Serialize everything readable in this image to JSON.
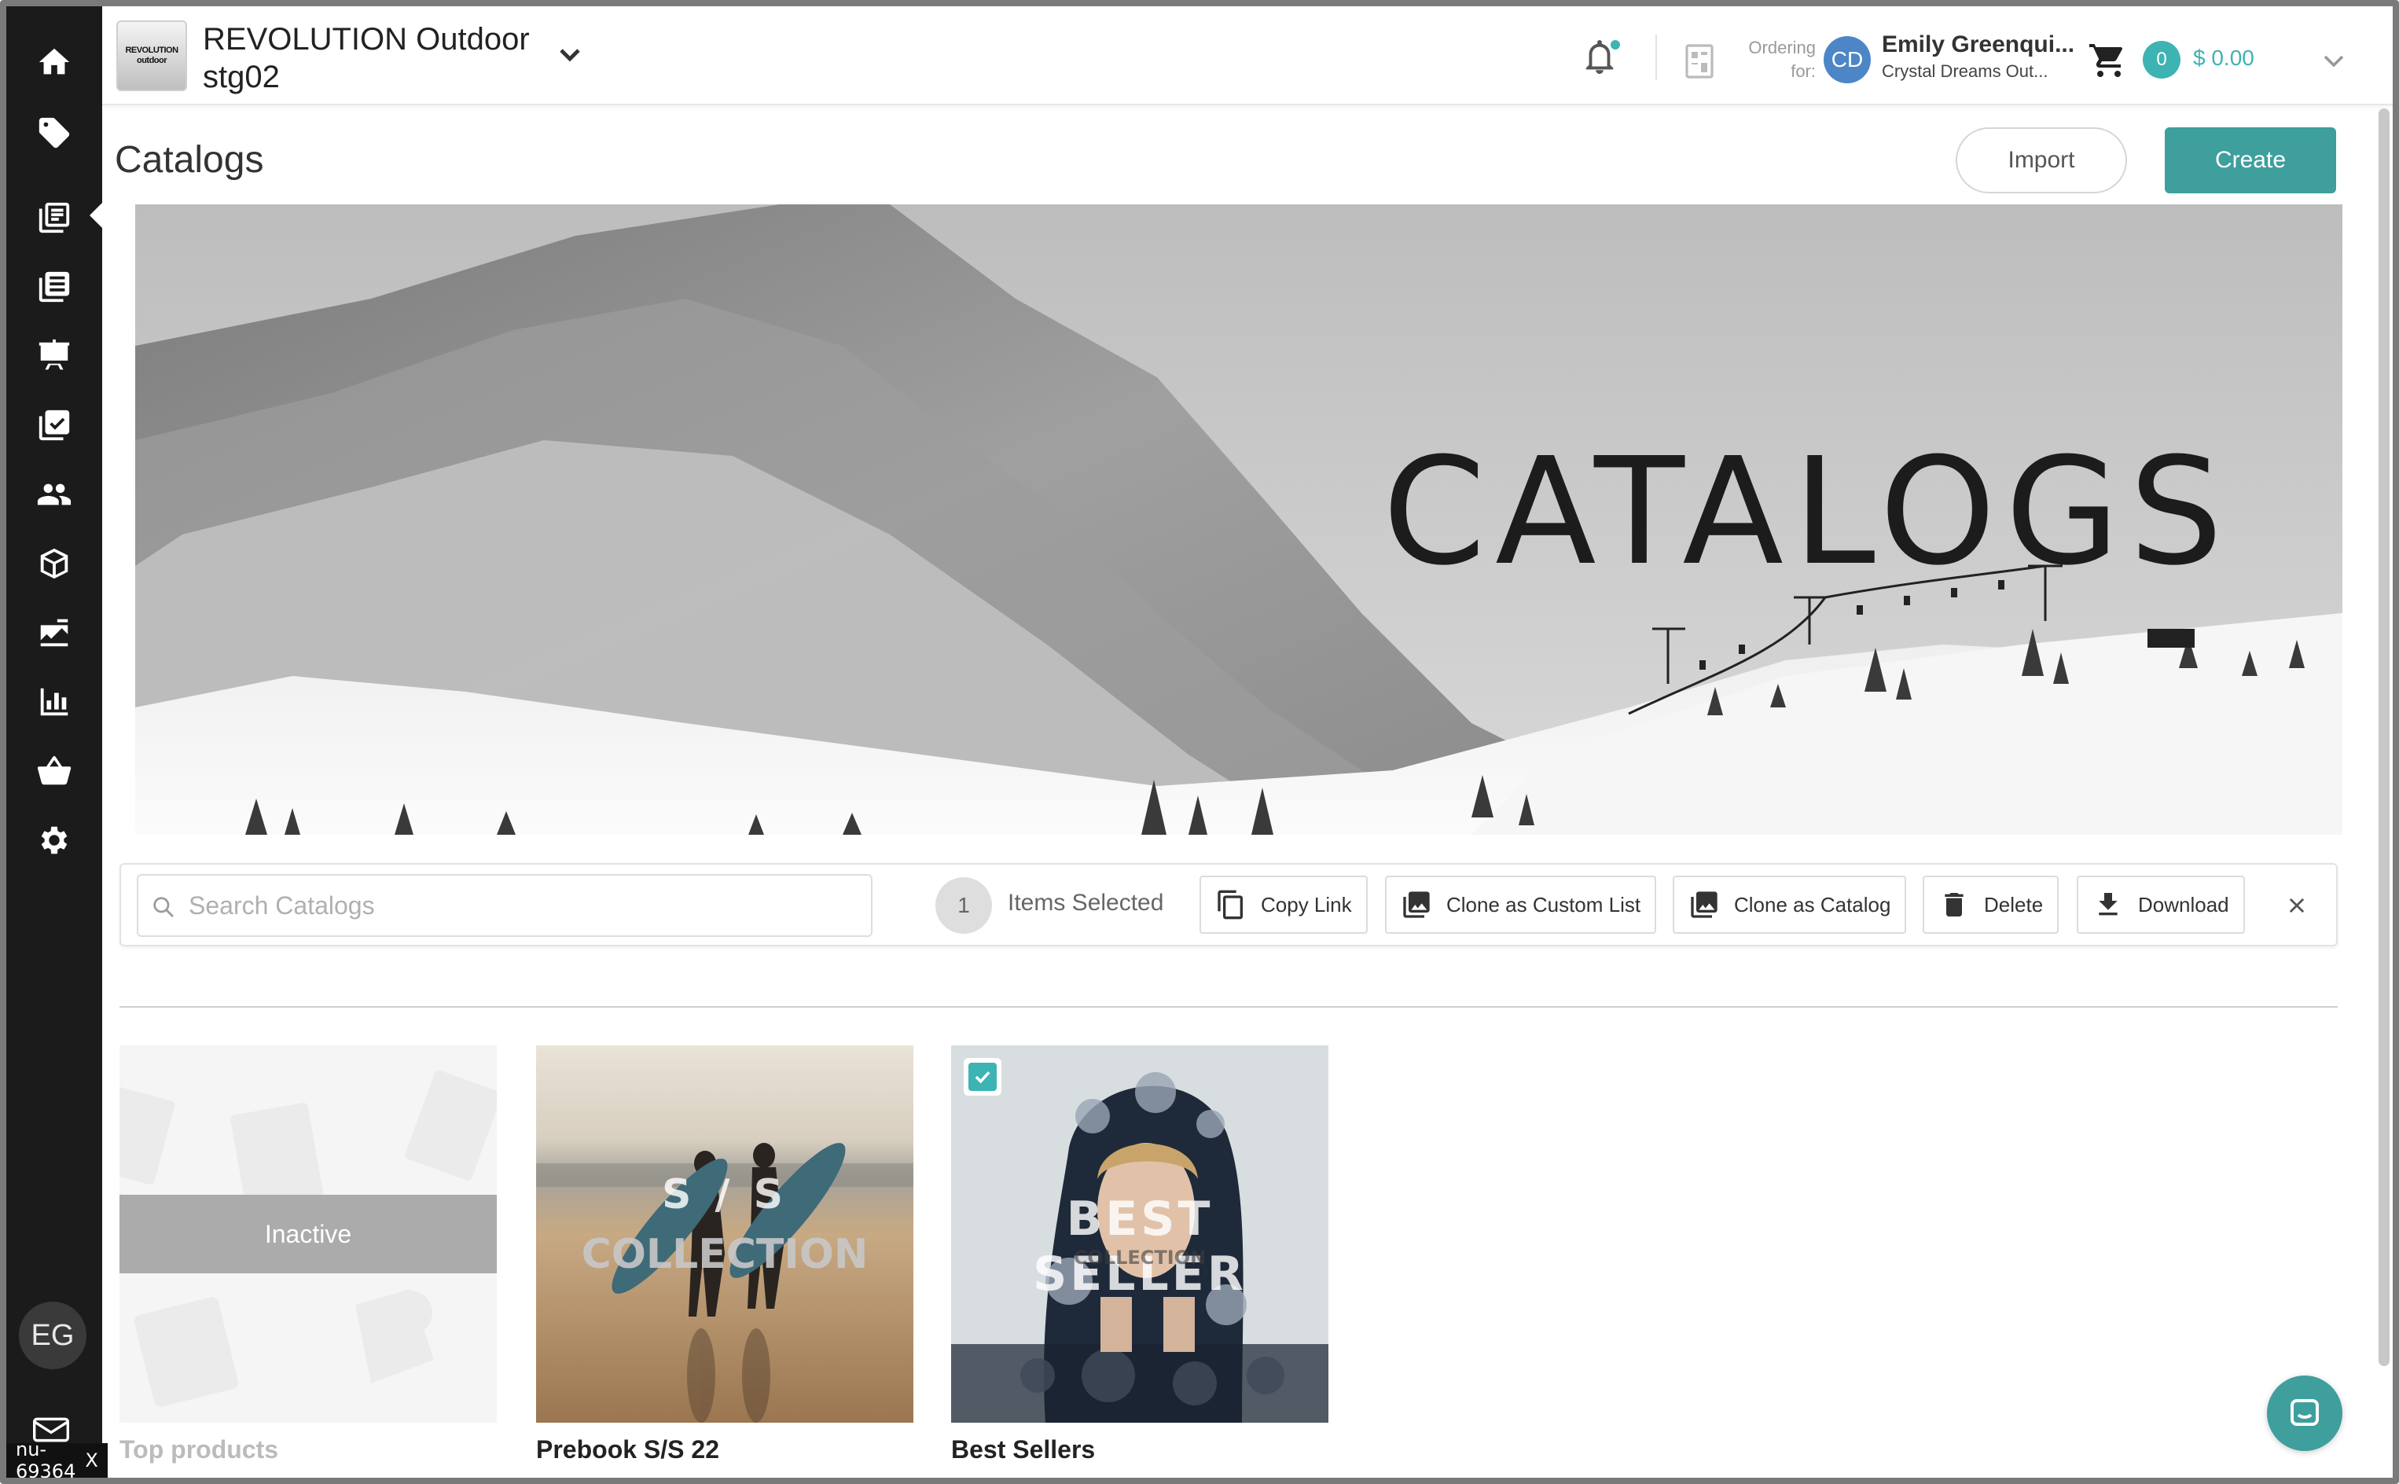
{
  "header": {
    "brand_logo_line1": "REVOLUTION",
    "brand_logo_line2": "outdoor",
    "brand_name": "REVOLUTION Outdoor",
    "brand_sub": "stg02",
    "ordering_label_1": "Ordering",
    "ordering_label_2": "for:",
    "customer_initials": "CD",
    "customer_name": "Emily Greenqui...",
    "customer_company": "Crystal Dreams Out...",
    "cart_count": "0",
    "cart_total": "$ 0.00"
  },
  "sidebar": {
    "items": [
      "home-icon",
      "tag-icon",
      "catalogs-icon",
      "orders-icon",
      "presentation-icon",
      "checklist-icon",
      "customers-icon",
      "products-icon",
      "campaigns-icon",
      "reports-icon",
      "basket-icon",
      "settings-icon"
    ],
    "active_item": "catalogs-icon",
    "user_initials": "EG",
    "env_tag": "nu-69364",
    "env_tag_close": "X"
  },
  "page": {
    "title": "Catalogs",
    "import_label": "Import",
    "create_label": "Create"
  },
  "hero": {
    "title": "CATALOGS"
  },
  "toolbar": {
    "search_placeholder": "Search Catalogs",
    "selected_count": "1",
    "selected_label": "Items Selected",
    "copy_link": "Copy Link",
    "clone_custom_list": "Clone as Custom List",
    "clone_catalog": "Clone as Catalog",
    "delete": "Delete",
    "download": "Download"
  },
  "catalogs": [
    {
      "title": "Top products",
      "status": "Inactive",
      "selected": false
    },
    {
      "title": "Prebook S/S 22",
      "overlay_line1": "S / S",
      "overlay_line2": "COLLECTION",
      "selected": false
    },
    {
      "title": "Best Sellers",
      "overlay_line1": "BEST SELLER",
      "overlay_line2": "COLLECTION",
      "selected": true
    }
  ],
  "colors": {
    "accent": "#3e9f9d",
    "teal_badge": "#3eb3b3",
    "sidebar_bg": "#1b1b1b",
    "customer_avatar": "#4d86c6"
  }
}
